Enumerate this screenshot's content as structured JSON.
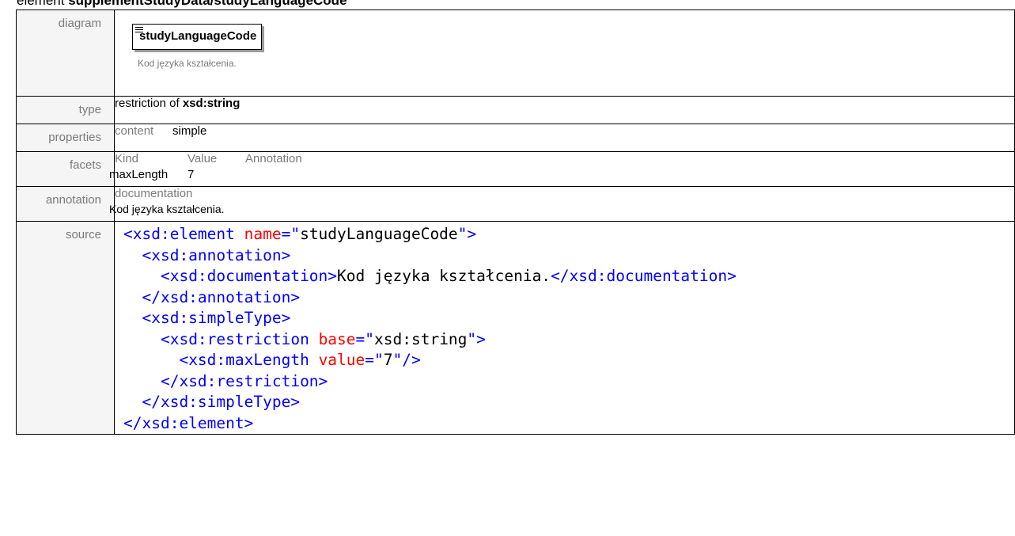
{
  "heading": {
    "prefix": "element ",
    "path": "supplementStudyData/studyLanguageCode"
  },
  "labels": {
    "diagram": "diagram",
    "type": "type",
    "properties": "properties",
    "facets": "facets",
    "annotation": "annotation",
    "source": "source"
  },
  "diagram": {
    "element_name": "studyLanguageCode",
    "documentation": "Kod języka kształcenia."
  },
  "type": {
    "prefix": "restriction of ",
    "base": "xsd:string"
  },
  "properties": {
    "key": "content",
    "value": "simple"
  },
  "facets": {
    "headers": [
      "Kind",
      "Value",
      "Annotation"
    ],
    "rows": [
      {
        "kind": "maxLength",
        "value": "7",
        "annotation": ""
      }
    ]
  },
  "annotation": {
    "header": "documentation",
    "text": "Kod języka kształcenia."
  },
  "source": {
    "lines": [
      [
        {
          "c": "t",
          "s": "<xsd:element "
        },
        {
          "c": "a",
          "s": "name"
        },
        {
          "c": "t",
          "s": "=\""
        },
        {
          "c": "v",
          "s": "studyLanguageCode"
        },
        {
          "c": "t",
          "s": "\">"
        }
      ],
      [
        {
          "c": "x",
          "s": "  "
        },
        {
          "c": "t",
          "s": "<xsd:annotation>"
        }
      ],
      [
        {
          "c": "x",
          "s": "    "
        },
        {
          "c": "t",
          "s": "<xsd:documentation>"
        },
        {
          "c": "x",
          "s": "Kod języka kształcenia."
        },
        {
          "c": "t",
          "s": "</xsd:documentation>"
        }
      ],
      [
        {
          "c": "x",
          "s": "  "
        },
        {
          "c": "t",
          "s": "</xsd:annotation>"
        }
      ],
      [
        {
          "c": "x",
          "s": "  "
        },
        {
          "c": "t",
          "s": "<xsd:simpleType>"
        }
      ],
      [
        {
          "c": "x",
          "s": "    "
        },
        {
          "c": "t",
          "s": "<xsd:restriction "
        },
        {
          "c": "a",
          "s": "base"
        },
        {
          "c": "t",
          "s": "=\""
        },
        {
          "c": "v",
          "s": "xsd:string"
        },
        {
          "c": "t",
          "s": "\">"
        }
      ],
      [
        {
          "c": "x",
          "s": "      "
        },
        {
          "c": "t",
          "s": "<xsd:maxLength "
        },
        {
          "c": "a",
          "s": "value"
        },
        {
          "c": "t",
          "s": "=\""
        },
        {
          "c": "v",
          "s": "7"
        },
        {
          "c": "t",
          "s": "\"/>"
        }
      ],
      [
        {
          "c": "x",
          "s": "    "
        },
        {
          "c": "t",
          "s": "</xsd:restriction>"
        }
      ],
      [
        {
          "c": "x",
          "s": "  "
        },
        {
          "c": "t",
          "s": "</xsd:simpleType>"
        }
      ],
      [
        {
          "c": "t",
          "s": "</xsd:element>"
        }
      ]
    ]
  },
  "colors": {
    "tag": "#0000ff",
    "attribute": "#ff0000",
    "label_text": "#7a7a7a",
    "label_bg": "#f5f5f5"
  }
}
